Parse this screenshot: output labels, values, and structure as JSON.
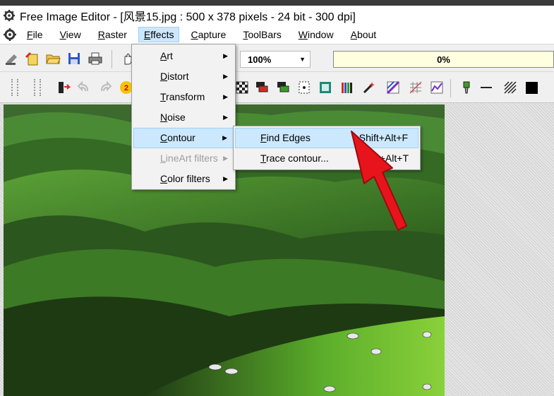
{
  "window": {
    "title": "Free Image Editor - [风景15.jpg : 500 x 378 pixels - 24 bit - 300 dpi]"
  },
  "menubar": {
    "items": [
      {
        "key": "F",
        "rest": "ile"
      },
      {
        "key": "V",
        "rest": "iew"
      },
      {
        "key": "R",
        "rest": "aster"
      },
      {
        "key": "E",
        "rest": "ffects"
      },
      {
        "key": "C",
        "rest": "apture"
      },
      {
        "key": "T",
        "rest": "oolBars"
      },
      {
        "key": "W",
        "rest": "indow"
      },
      {
        "key": "A",
        "rest": "bout"
      }
    ]
  },
  "toolbar": {
    "zoom_value": "100%",
    "progress_text": "0%"
  },
  "effects_menu": {
    "items": [
      {
        "key": "A",
        "rest": "rt"
      },
      {
        "key": "D",
        "rest": "istort"
      },
      {
        "key": "T",
        "rest": "ransform"
      },
      {
        "key": "N",
        "rest": "oise"
      },
      {
        "key": "C",
        "rest": "ontour"
      },
      {
        "key": "L",
        "rest": "ineArt filters"
      },
      {
        "key": "C",
        "rest": "olor filters"
      }
    ]
  },
  "contour_submenu": {
    "items": [
      {
        "key": "F",
        "rest": "ind Edges",
        "shortcut": "Shift+Alt+F"
      },
      {
        "key": "T",
        "rest": "race contour...",
        "shortcut": "Shift+Alt+T"
      }
    ]
  },
  "colors": {
    "highlight": "#cce8ff",
    "highlight_border": "#99d1ff",
    "progress_bg": "#ffffe0",
    "annotation_arrow": "#e8141c"
  }
}
